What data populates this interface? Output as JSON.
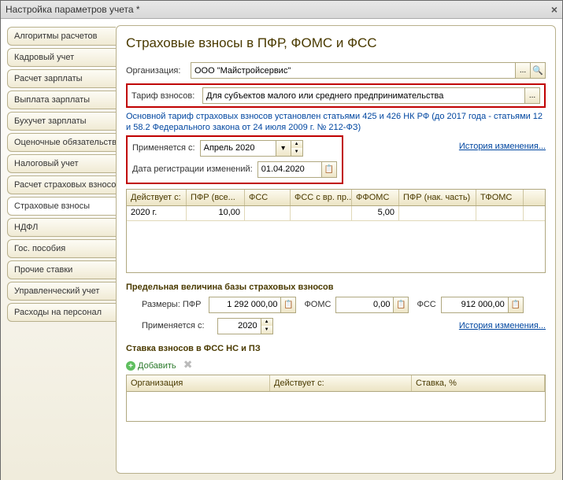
{
  "window_title": "Настройка параметров учета *",
  "sidebar": {
    "items": [
      "Алгоритмы расчетов",
      "Кадровый учет",
      "Расчет зарплаты",
      "Выплата зарплаты",
      "Бухучет зарплаты",
      "Оценочные обязательства",
      "Налоговый учет",
      "Расчет страховых взносов",
      "Страховые взносы",
      "НДФЛ",
      "Гос. пособия",
      "Прочие ставки",
      "Управленческий учет",
      "Расходы на персонал"
    ],
    "active_index": 8
  },
  "header": "Страховые взносы в ПФР, ФОМС и ФСС",
  "org": {
    "label": "Организация:",
    "value": "ООО \"Майстройсервис\""
  },
  "tariff": {
    "label": "Тариф взносов:",
    "value": "Для субъектов малого или среднего предпринимательства"
  },
  "note": "Основной тариф страховых взносов установлен статьями 425 и 426 НК РФ (до 2017 года - статьями 12 и 58.2 Федерального закона от 24 июля 2009 г. № 212-ФЗ)",
  "applies": {
    "label": "Применяется с:",
    "value": "Апрель  2020"
  },
  "regdate": {
    "label": "Дата регистрации изменений:",
    "value": "01.04.2020"
  },
  "history": "История изменения...",
  "table1": {
    "headers": [
      "Действует с:",
      "ПФР (все...",
      "ФСС",
      "ФСС с вр. пр...",
      "ФФОМС",
      "ПФР (нак. часть)",
      "ТФОМС"
    ],
    "row": [
      "2020 г.",
      "10,00",
      "",
      "",
      "5,00",
      "",
      ""
    ]
  },
  "limits": {
    "title": "Предельная величина базы страховых взносов",
    "sizes": "Размеры: ПФР",
    "pfr": "1 292 000,00",
    "foms_lbl": "ФОМС",
    "foms": "0,00",
    "fss_lbl": "ФСС",
    "fss": "912 000,00",
    "applies_lbl": "Применяется с:",
    "year": "2020"
  },
  "fssns": {
    "title": "Ставка взносов в ФСС НС и ПЗ",
    "add": "Добавить",
    "headers": [
      "Организация",
      "Действует с:",
      "Ставка, %"
    ]
  }
}
